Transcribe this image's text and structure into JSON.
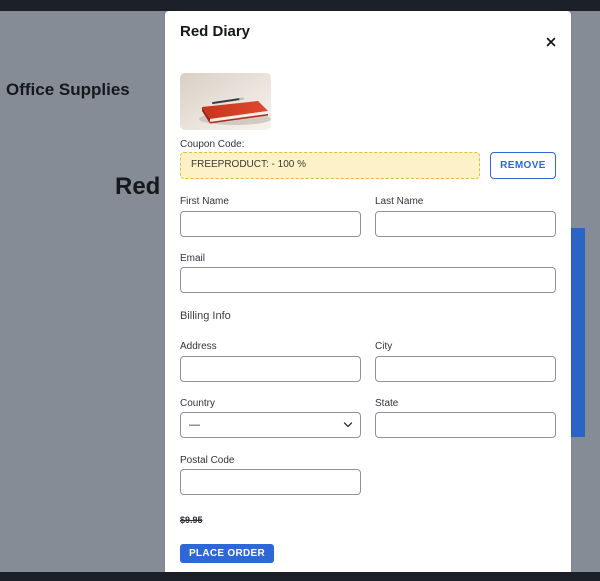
{
  "background": {
    "heading": "Office Supplies",
    "product_title": "Red"
  },
  "modal": {
    "title": "Red Diary",
    "close_label": "×",
    "image_alt": "red-diary-with-pen",
    "coupon": {
      "label": "Coupon Code:",
      "value": "FREEPRODUCT: - 100 %",
      "remove_label": "REMOVE"
    },
    "fields": {
      "first_name": {
        "label": "First Name",
        "value": ""
      },
      "last_name": {
        "label": "Last Name",
        "value": ""
      },
      "email": {
        "label": "Email",
        "value": ""
      }
    },
    "billing": {
      "title": "Billing Info",
      "address": {
        "label": "Address",
        "value": ""
      },
      "city": {
        "label": "City",
        "value": ""
      },
      "country": {
        "label": "Country",
        "selected": "—"
      },
      "state": {
        "label": "State",
        "value": ""
      },
      "postal_code": {
        "label": "Postal Code",
        "value": ""
      }
    },
    "price": "$9.95",
    "place_order_label": "PLACE ORDER"
  },
  "colors": {
    "accent": "#2d68d6",
    "coupon_bg": "#fdf1c8",
    "coupon_border": "#e2bd3b",
    "overlay": "#868c96"
  }
}
